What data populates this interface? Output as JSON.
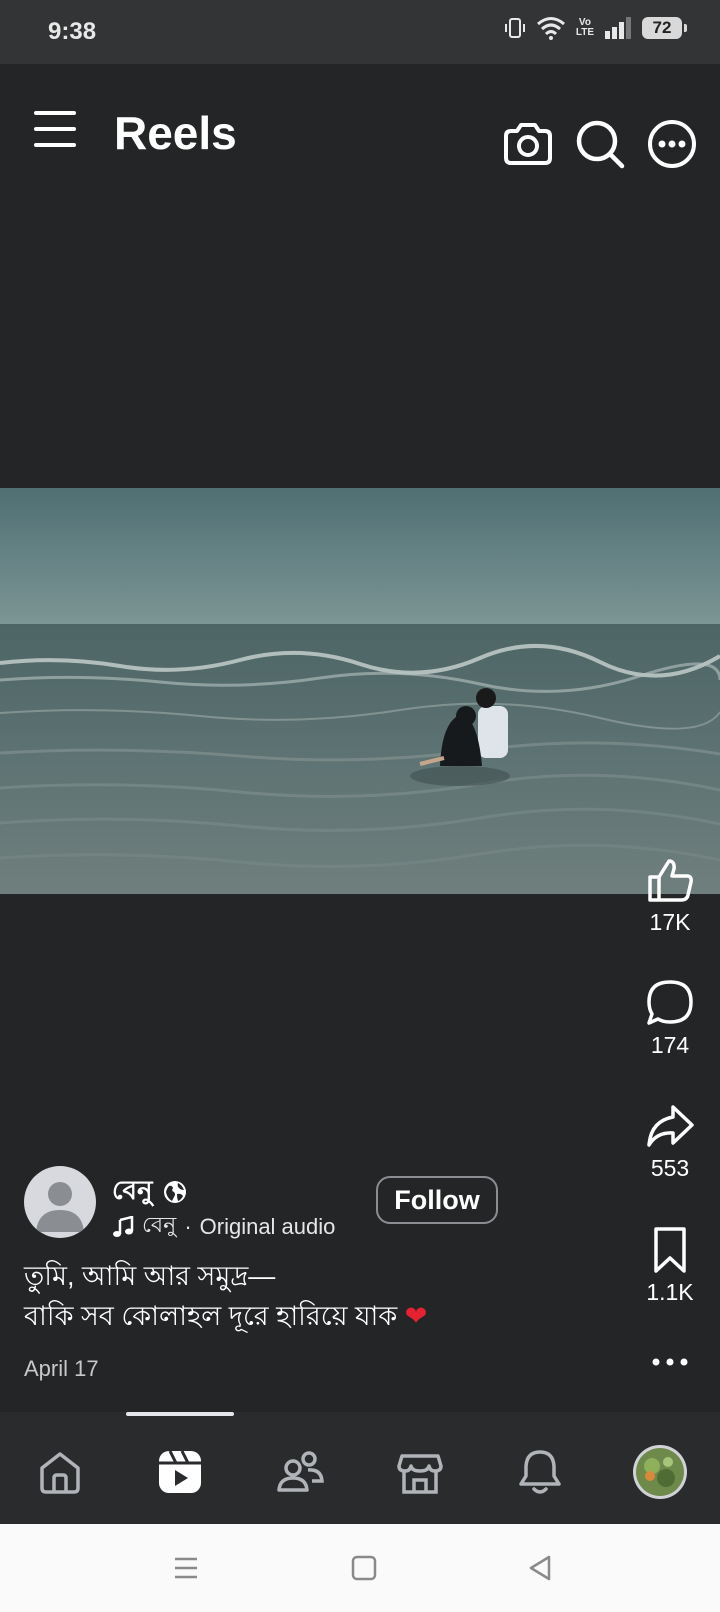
{
  "status_bar": {
    "time": "9:38",
    "volte_top": "Vo",
    "volte_bottom": "LTE",
    "battery": "72"
  },
  "header": {
    "title": "Reels",
    "icons": [
      "menu-icon",
      "camera-icon",
      "search-icon",
      "more-horizontal-icon"
    ]
  },
  "actions": {
    "likes": "17K",
    "comments": "174",
    "shares": "553",
    "saves": "1.1K"
  },
  "post": {
    "author": "বেনু",
    "audio_author": "বেনু",
    "audio_label": "Original audio",
    "follow_label": "Follow",
    "caption_line1": "তুমি, আমি আর সমুদ্র—",
    "caption_line2": "বাকি সব কোলাহল দূরে হারিয়ে যাক",
    "caption_emoji": "❤",
    "date": "April 17"
  },
  "bottom_nav": {
    "items": [
      "home-icon",
      "reels-icon",
      "friends-icon",
      "marketplace-icon",
      "notifications-icon",
      "profile-avatar"
    ],
    "active": "reels-icon"
  },
  "colors": {
    "background": "#242526",
    "status_bar": "#333436",
    "nav_bar": "#2a2b2d",
    "heart": "#e62232"
  }
}
